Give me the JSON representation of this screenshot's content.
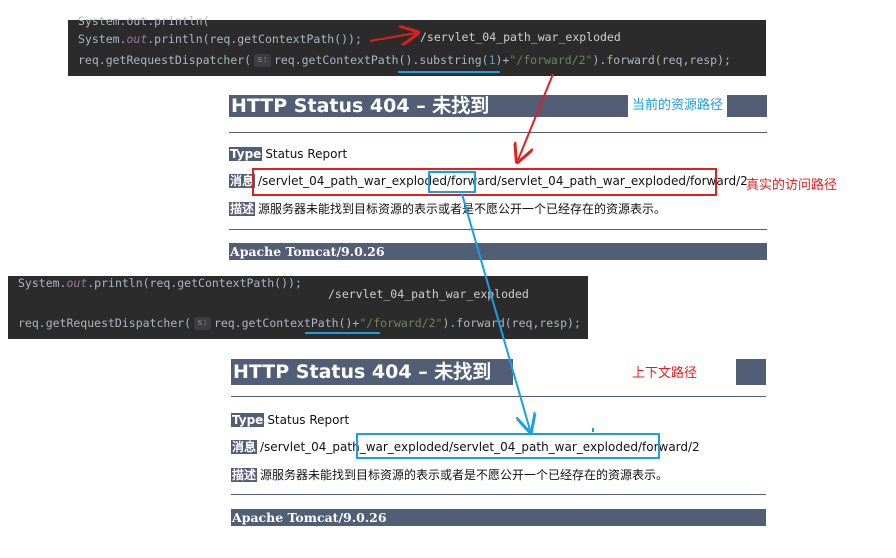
{
  "code_top": {
    "line0": "System.out.println(",
    "line1_a": "System.",
    "line1_out": "out",
    "line1_b": ".println(req.getContextPath());",
    "output": "/servlet_04_path_war_exploded",
    "line2_a": "req.getRequestDispatcher(",
    "hint": "s:",
    "line2_b": "req.getContextPath().substring(",
    "line2_num": "1",
    "line2_c": ")+",
    "line2_str": "\"/forward/2\"",
    "line2_d": ").forward(req,resp);"
  },
  "page_top": {
    "title": "HTTP Status 404 – 未找到",
    "annotation": "当前的资源路径",
    "type_label": "Type",
    "type_value": "Status Report",
    "msg_label": "消息",
    "msg_part1": "/servlet_04_path_war_exploded/",
    "msg_part2": "forward",
    "msg_part3": "/servlet_04_path_war_exploded/forward/2",
    "desc_label": "描述",
    "desc_value": "源服务器未能找到目标资源的表示或者是不愿公开一个已经存在的资源表示。",
    "footer": "Apache Tomcat/9.0.26",
    "real_path_annotation": "真实的访问路径"
  },
  "code_bottom": {
    "line1_a": "System.",
    "line1_out": "out",
    "line1_b": ".println(req.getContextPath());",
    "output": "/servlet_04_path_war_exploded",
    "line2_a": "req.getRequestDispatcher(",
    "hint": "s:",
    "line2_b": "req.getContextPath()+",
    "line2_str": "\"/forward/2\"",
    "line2_d": ").forward(req,resp);"
  },
  "page_bottom": {
    "title": "HTTP Status 404 – 未找到",
    "annotation": "上下文路径",
    "type_label": "Type",
    "type_value": "Status Report",
    "msg_label": "消息",
    "msg_part1": "/servlet_04_path_",
    "msg_part2": "war_exploded/servlet_04_path_war_exploded/forward/2",
    "desc_label": "描述",
    "desc_value": "源服务器未能找到目标资源的表示或者是不愿公开一个已经存在的资源表示。",
    "footer": "Apache Tomcat/9.0.26"
  },
  "colors": {
    "tomcat_blue_gray": "#525d76",
    "annotation_red": "#e02020",
    "annotation_cyan": "#1aa0e0",
    "code_bg": "#2b2b2b"
  }
}
